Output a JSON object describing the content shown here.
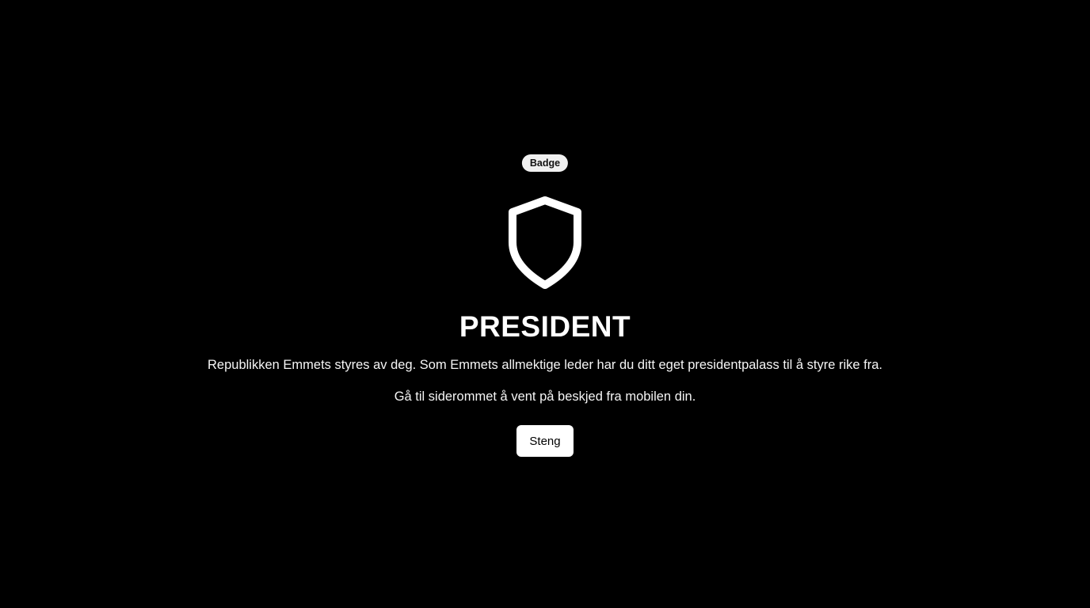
{
  "badge": {
    "label": "Badge"
  },
  "icon": {
    "name": "shield-icon",
    "color": "#ffffff"
  },
  "role": {
    "title": "PRESIDENT",
    "description": "Republikken Emmets styres av deg. Som Emmets allmektige leder har du ditt eget presidentpalass til å styre rike fra.",
    "instruction": "Gå til siderommet å vent på beskjed fra mobilen din."
  },
  "actions": {
    "close_label": "Steng"
  },
  "colors": {
    "background": "#000000",
    "text": "#ffffff",
    "badge_background": "#f1f1f1",
    "button_background": "#ffffff",
    "button_text": "#000000"
  }
}
